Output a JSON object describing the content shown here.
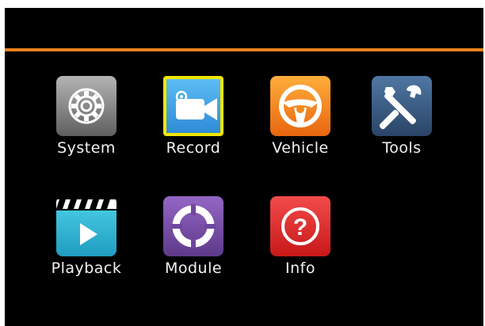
{
  "colors": {
    "background": "#000000",
    "accent_line": "#e8821e",
    "selection_border": "#f2e600",
    "label_text": "#f2f2f2"
  },
  "menu": {
    "selected": "Record",
    "items": [
      {
        "label": "System",
        "icon": "gear-icon",
        "tile_color": "#8a8a8a"
      },
      {
        "label": "Record",
        "icon": "video-camera-icon",
        "tile_color": "#3fa6e8"
      },
      {
        "label": "Vehicle",
        "icon": "steering-wheel-icon",
        "tile_color": "#f08a1c"
      },
      {
        "label": "Tools",
        "icon": "tools-icon",
        "tile_color": "#3a5a80"
      },
      {
        "label": "Playback",
        "icon": "clapperboard-play-icon",
        "tile_color": "#2fb3d1"
      },
      {
        "label": "Module",
        "icon": "module-ring-icon",
        "tile_color": "#7c4fa8"
      },
      {
        "label": "Info",
        "icon": "question-icon",
        "tile_color": "#e02b2b"
      }
    ]
  }
}
